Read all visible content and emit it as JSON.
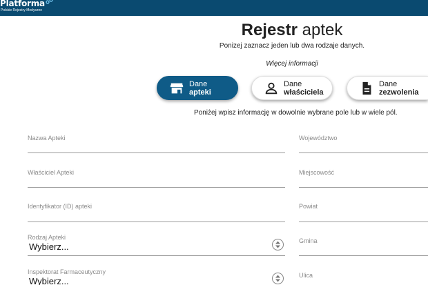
{
  "header": {
    "logo_title": "Platforma",
    "logo_subtitle": "Polskie Rejestry Medyczne",
    "bar_color": "#0a4a70"
  },
  "page": {
    "title_strong": "Rejestr",
    "title_light": "aptek",
    "instruction": "Ponizej zaznacz jeden lub dwa rodzaje danych.",
    "more_info": "Więcej informacji",
    "fields_instruction": "Poniżej wpisz informację w dowolnie wybrane pole lub w wiele pól."
  },
  "data_types": [
    {
      "line1": "Dane",
      "line2": "apteki",
      "icon": "storefront-icon",
      "active": true
    },
    {
      "line1": "Dane",
      "line2": "właściciela",
      "icon": "person-icon",
      "active": false
    },
    {
      "line1": "Dane",
      "line2": "zezwolenia",
      "icon": "document-icon",
      "active": false
    }
  ],
  "form": {
    "left": [
      {
        "label": "Nazwa Apteki"
      },
      {
        "label": "Właściciel Apteki"
      },
      {
        "label": "Identyfikator (ID) apteki"
      },
      {
        "label": "Rodzaj Apteki",
        "value": "Wybierz..."
      },
      {
        "label": "Inspektorat Farmaceutyczny",
        "value": "Wybierz..."
      }
    ],
    "right": [
      {
        "label": "Województwo"
      },
      {
        "label": "Miejscowość"
      },
      {
        "label": "Powiat"
      },
      {
        "label": "Gmina"
      },
      {
        "label": "Ulica"
      }
    ]
  },
  "colors": {
    "accent": "#0f5b87"
  }
}
